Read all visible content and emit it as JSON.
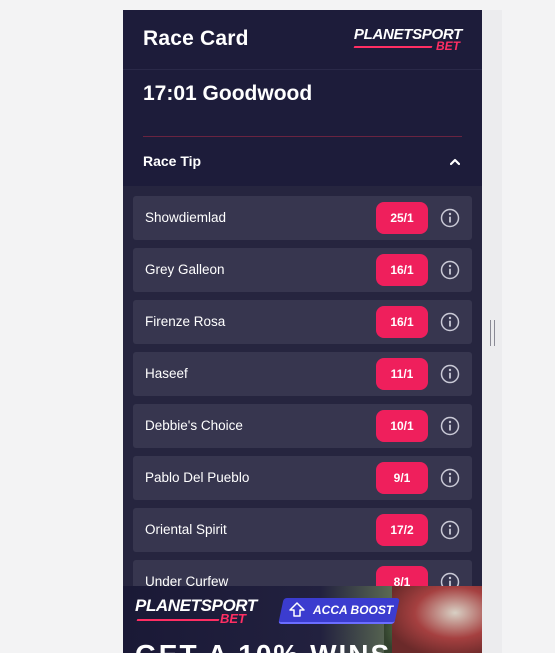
{
  "header": {
    "title": "Race Card",
    "logo_line1": "PLANETSPORT",
    "logo_line2": "BET"
  },
  "race": {
    "time_venue": "17:01 Goodwood"
  },
  "tip_section": {
    "label": "Race Tip",
    "expanded": true
  },
  "runners": [
    {
      "name": "Showdiemlad",
      "odds": "25/1"
    },
    {
      "name": "Grey Galleon",
      "odds": "16/1"
    },
    {
      "name": "Firenze Rosa",
      "odds": "16/1"
    },
    {
      "name": "Haseef",
      "odds": "11/1"
    },
    {
      "name": "Debbie's Choice",
      "odds": "10/1"
    },
    {
      "name": "Pablo Del Pueblo",
      "odds": "9/1"
    },
    {
      "name": "Oriental Spirit",
      "odds": "17/2"
    },
    {
      "name": "Under Curfew",
      "odds": "8/1"
    }
  ],
  "banner": {
    "logo_line1": "PLANETSPORT",
    "logo_line2": "BET",
    "acca_label": "ACCA BOOST",
    "partial_text": "GET A 10% WINS"
  },
  "colors": {
    "background": "#1d1c3a",
    "row": "#37364f",
    "odds": "#ef1f5c",
    "accent": "#ff2e63"
  }
}
